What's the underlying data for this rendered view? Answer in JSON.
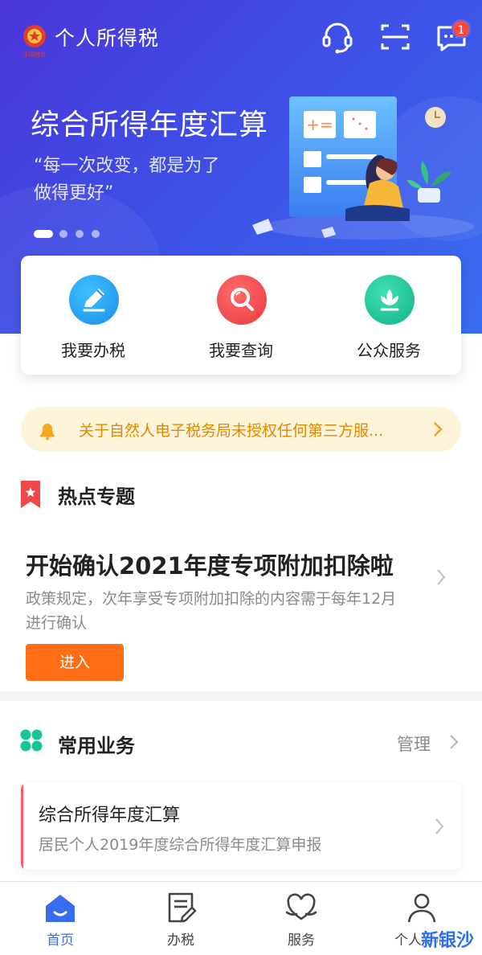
{
  "header": {
    "app_title": "个人所得税",
    "logo_text": "中国税务",
    "message_badge": "1"
  },
  "banner": {
    "title": "综合所得年度汇算",
    "subtitle_line1": "“每一次改变，都是为了",
    "subtitle_line2": "做得更好”",
    "slide_count": 4,
    "active_slide": 1
  },
  "quick_actions": [
    {
      "label": "我要办税",
      "icon": "pencil-icon",
      "color": "#1fa4f0"
    },
    {
      "label": "我要查询",
      "icon": "magnifier-icon",
      "color": "#f2484a"
    },
    {
      "label": "公众服务",
      "icon": "lotus-icon",
      "color": "#18c49a"
    }
  ],
  "notice": {
    "text": "关于自然人电子税务局未授权任何第三方服..."
  },
  "hot_topics": {
    "section_title": "热点专题",
    "headline": "开始确认2021年度专项附加扣除啦",
    "desc_line1": "政策规定，次年享受专项附加扣除的内容需于每年12月",
    "desc_line2": "进行确认",
    "button_label": "进入"
  },
  "common_business": {
    "section_title": "常用业务",
    "manage_label": "管理",
    "items": [
      {
        "title": "综合所得年度汇算",
        "subtitle": "居民个人2019年度综合所得年度汇算申报"
      }
    ]
  },
  "tabbar": {
    "tabs": [
      {
        "label": "首页",
        "icon": "home-icon",
        "active": true
      },
      {
        "label": "办税",
        "icon": "document-icon",
        "active": false
      },
      {
        "label": "服务",
        "icon": "heart-icon",
        "active": false
      },
      {
        "label": "个人中心",
        "icon": "user-icon",
        "active": false
      }
    ]
  },
  "watermark": "新银沙",
  "colors": {
    "primary": "#3a6cf0",
    "accent_orange": "#ff6d14",
    "notice_bg": "#fdf3d8",
    "notice_text": "#e08a00"
  }
}
